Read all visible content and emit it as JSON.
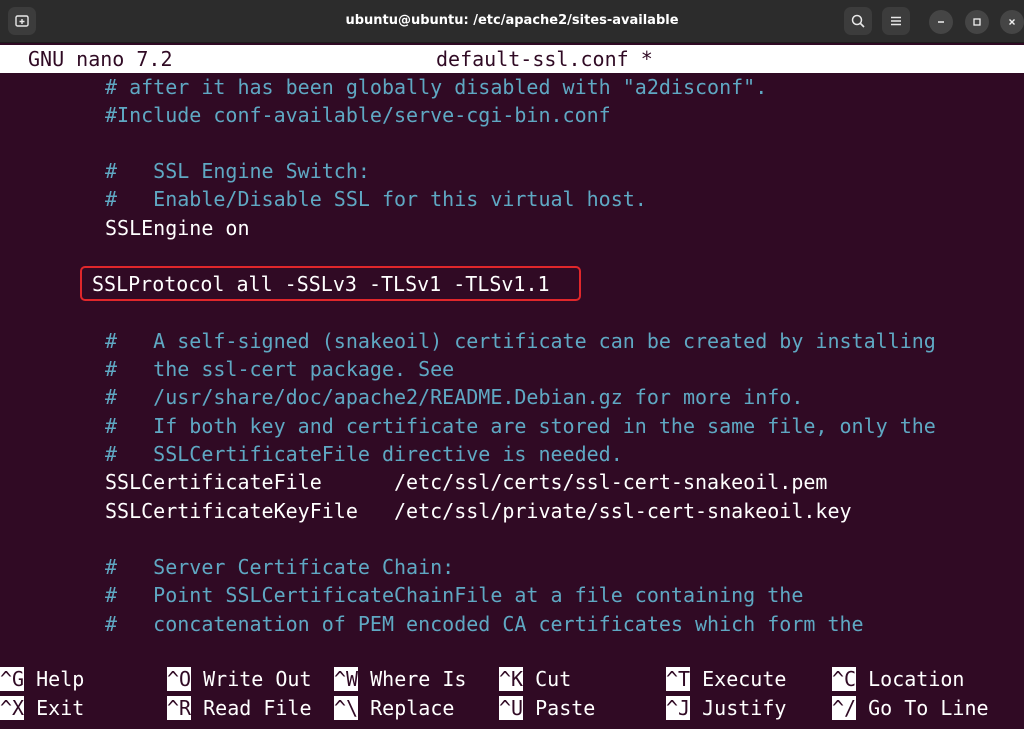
{
  "window": {
    "title": "ubuntu@ubuntu: /etc/apache2/sites-available"
  },
  "nano": {
    "version": "GNU nano 7.2",
    "filename": "default-ssl.conf *"
  },
  "editor_lines": [
    "# after it has been globally disabled with \"a2disconf\".",
    "#Include conf-available/serve-cgi-bin.conf",
    "",
    "#   SSL Engine Switch:",
    "#   Enable/Disable SSL for this virtual host.",
    "SSLEngine on",
    "",
    "SSLProtocol all -SSLv3 -TLSv1 -TLSv1.1",
    "",
    "#   A self-signed (snakeoil) certificate can be created by installing",
    "#   the ssl-cert package. See",
    "#   /usr/share/doc/apache2/README.Debian.gz for more info.",
    "#   If both key and certificate are stored in the same file, only the",
    "#   SSLCertificateFile directive is needed.",
    "SSLCertificateFile      /etc/ssl/certs/ssl-cert-snakeoil.pem",
    "SSLCertificateKeyFile   /etc/ssl/private/ssl-cert-snakeoil.key",
    "",
    "#   Server Certificate Chain:",
    "#   Point SSLCertificateChainFile at a file containing the",
    "#   concatenation of PEM encoded CA certificates which form the"
  ],
  "shortcuts": [
    {
      "key": "^G",
      "label": "Help"
    },
    {
      "key": "^O",
      "label": "Write Out"
    },
    {
      "key": "^W",
      "label": "Where Is"
    },
    {
      "key": "^K",
      "label": "Cut"
    },
    {
      "key": "^T",
      "label": "Execute"
    },
    {
      "key": "^C",
      "label": "Location"
    },
    {
      "key": "^X",
      "label": "Exit"
    },
    {
      "key": "^R",
      "label": "Read File"
    },
    {
      "key": "^\\",
      "label": "Replace"
    },
    {
      "key": "^U",
      "label": "Paste"
    },
    {
      "key": "^J",
      "label": "Justify"
    },
    {
      "key": "^/",
      "label": "Go To Line"
    }
  ],
  "icons": {
    "new_tab": "new-tab-icon",
    "search": "search-icon",
    "menu": "hamburger-menu-icon",
    "minimize": "minimize-icon",
    "maximize": "maximize-icon",
    "close": "close-icon"
  },
  "colors": {
    "terminal_bg": "#300a24",
    "comment": "#5fa8c3",
    "highlight_border": "#e0272b"
  }
}
